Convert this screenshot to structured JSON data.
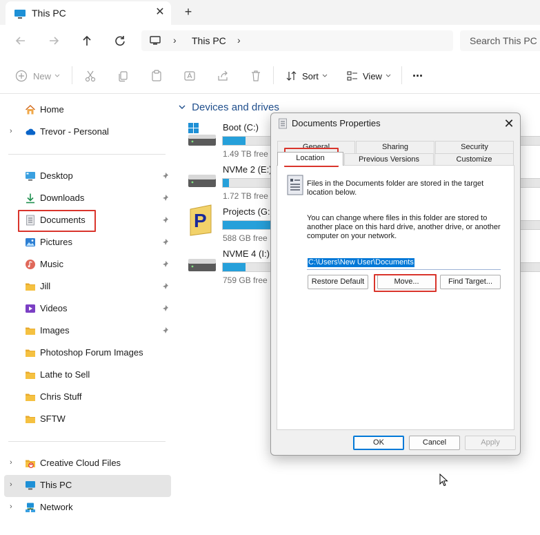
{
  "window": {
    "tab_title": "This PC",
    "tab_close": "✕",
    "new_tab": "+",
    "pc_icon": "monitor-icon"
  },
  "address": {
    "crumb": "This PC",
    "sep": "›",
    "search_placeholder": "Search This PC"
  },
  "commands": {
    "new": "New",
    "sort": "Sort",
    "view": "View",
    "more": "···"
  },
  "sidebar": {
    "top": [
      {
        "label": "Home",
        "icon": "home-icon"
      },
      {
        "label": "Trevor - Personal",
        "icon": "cloud-icon"
      }
    ],
    "quick": [
      {
        "label": "Desktop",
        "icon": "desktop-icon"
      },
      {
        "label": "Downloads",
        "icon": "download-icon"
      },
      {
        "label": "Documents",
        "icon": "document-icon"
      },
      {
        "label": "Pictures",
        "icon": "pictures-icon"
      },
      {
        "label": "Music",
        "icon": "music-icon"
      },
      {
        "label": "Jill",
        "icon": "folder-icon"
      },
      {
        "label": "Videos",
        "icon": "videos-icon"
      },
      {
        "label": "Images",
        "icon": "folder-icon"
      },
      {
        "label": "Photoshop Forum Images",
        "icon": "folder-icon"
      },
      {
        "label": "Lathe to Sell",
        "icon": "folder-icon"
      },
      {
        "label": "Chris Stuff",
        "icon": "folder-icon"
      },
      {
        "label": "SFTW",
        "icon": "folder-icon"
      }
    ],
    "bottom": [
      {
        "label": "Creative Cloud Files",
        "icon": "creative-cloud-icon"
      },
      {
        "label": "This PC",
        "icon": "monitor-icon"
      },
      {
        "label": "Network",
        "icon": "network-icon"
      }
    ]
  },
  "content": {
    "section_title": "Devices and drives",
    "drives": [
      {
        "name": "Boot (C:)",
        "free": "1.49 TB free",
        "used_fraction": 0.07,
        "icon": "windows-drive-icon"
      },
      {
        "name": "NVMe 2 (E:)",
        "free": "1.72 TB free",
        "used_fraction": 0.02,
        "icon": "drive-icon"
      },
      {
        "name": "Projects (G:)",
        "free": "588 GB free",
        "used_fraction": 0.15,
        "icon": "projects-drive-icon"
      },
      {
        "name": "NVME 4 (I:)",
        "free": "759 GB free",
        "used_fraction": 0.07,
        "icon": "drive-icon"
      }
    ]
  },
  "dialog": {
    "title": "Documents Properties",
    "close": "✕",
    "tabs_row1": [
      "General",
      "Sharing",
      "Security"
    ],
    "tabs_row2": [
      "Location",
      "Previous Versions",
      "Customize"
    ],
    "info_line1": "Files in the Documents folder are stored in the target",
    "info_line2": "location below.",
    "desc_line1": "You can change where files in this folder are stored to",
    "desc_line2": "another place on this hard drive, another drive, or another",
    "desc_line3": "computer on your network.",
    "path": "C:\\Users\\New User\\Documents",
    "restore_default": "Restore Default",
    "move": "Move...",
    "find_target": "Find Target...",
    "ok": "OK",
    "cancel": "Cancel",
    "apply": "Apply"
  },
  "colors": {
    "accent": "#0078d7",
    "drive_fill": "#26a0da",
    "highlight": "#d9342b",
    "folder": "#f5c141"
  }
}
